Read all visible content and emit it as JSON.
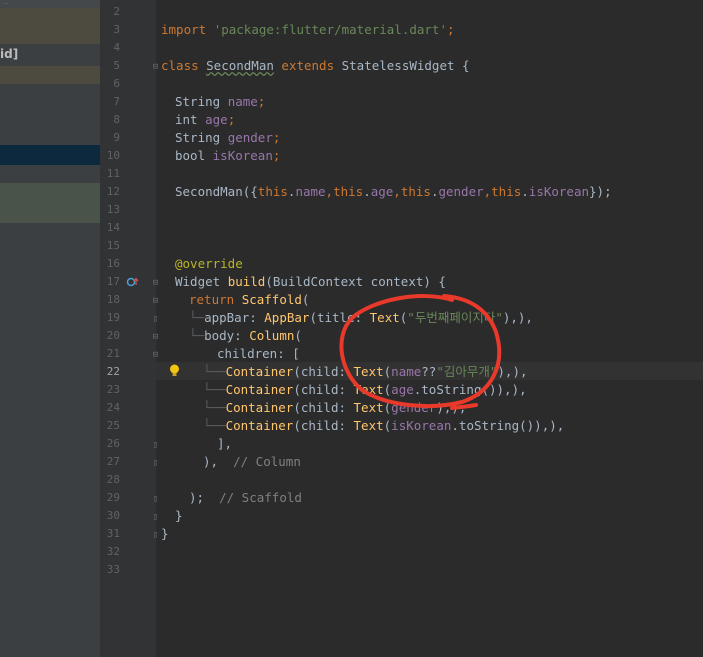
{
  "left_panel": {
    "fragment_top": "...",
    "fragment_label": "id]"
  },
  "line_numbers": [
    "2",
    "3",
    "4",
    "5",
    "6",
    "7",
    "8",
    "9",
    "10",
    "11",
    "12",
    "13",
    "14",
    "15",
    "16",
    "17",
    "18",
    "19",
    "20",
    "21",
    "22",
    "23",
    "24",
    "25",
    "26",
    "27",
    "28",
    "29",
    "30",
    "31",
    "32",
    "33"
  ],
  "current_line": "22",
  "code": {
    "l3": [
      "import ",
      "'package:flutter/material.dart'",
      ";"
    ],
    "l5": [
      "class ",
      "SecondMan",
      " extends ",
      "StatelessWidget",
      " {"
    ],
    "l7": [
      "String ",
      "name",
      ";"
    ],
    "l8": [
      "int ",
      "age",
      ";"
    ],
    "l9": [
      "String ",
      "gender",
      ";"
    ],
    "l10": [
      "bool ",
      "isKorean",
      ";"
    ],
    "l12": [
      "SecondMan({",
      "this",
      ".",
      "name",
      ",",
      "this",
      ".",
      "age",
      ",",
      "this",
      ".",
      "gender",
      ",",
      "this",
      ".",
      "isKorean",
      "});"
    ],
    "l16": [
      "@override"
    ],
    "l17": [
      "Widget ",
      "build",
      "(BuildContext context) {"
    ],
    "l18": [
      "return ",
      "Scaffold",
      "("
    ],
    "l19": [
      "appBar: ",
      "AppBar",
      "(title: ",
      "Text",
      "(",
      "\"두번째페이지다\"",
      "),),"
    ],
    "l20": [
      "body: ",
      "Column",
      "("
    ],
    "l21": [
      "children: ["
    ],
    "l22": [
      "Container",
      "(child: ",
      "Text",
      "(",
      "name",
      "??",
      "\"김아무개\"",
      "),),"
    ],
    "l23": [
      "Container",
      "(child: ",
      "Text",
      "(",
      "age",
      ".toString()),),"
    ],
    "l24": [
      "Container",
      "(child: ",
      "Text",
      "(",
      "gender",
      "),),"
    ],
    "l25": [
      "Container",
      "(child: ",
      "Text",
      "(",
      "isKorean",
      ".toString()),),"
    ],
    "l26": [
      "],"
    ],
    "l27": [
      "),  ",
      "// Column"
    ],
    "l29": [
      ");  ",
      "// Scaffold"
    ],
    "l30": [
      "}"
    ],
    "l31": [
      "}"
    ]
  },
  "icons": {
    "bulb": "lightbulb-icon",
    "override": "override-marker-icon"
  },
  "colors": {
    "background": "#2b2b2b",
    "keyword": "#cc7832",
    "string": "#6a8759",
    "field": "#9876aa",
    "method": "#ffc66d",
    "annotation_scribble": "#e8392a"
  }
}
